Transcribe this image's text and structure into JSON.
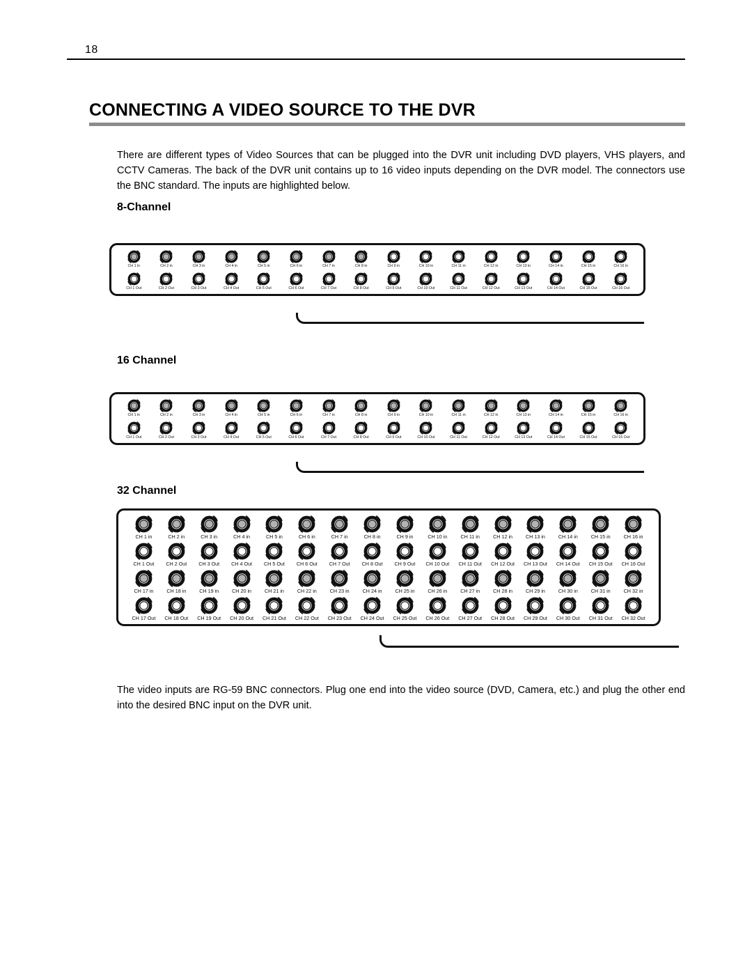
{
  "page": {
    "number": "18"
  },
  "title": "CONNECTING A VIDEO SOURCE TO THE DVR",
  "intro_paragraph": "There are different types of Video Sources that can be plugged into the DVR unit including DVD players, VHS players, and CCTV Cameras. The back of the DVR unit contains up to 16 video inputs depending on the DVR model. The connectors use the BNC standard.  The inputs are highlighted below.",
  "closing_paragraph": "The video inputs are RG-59 BNC connectors. Plug one end into the video source (DVD, Camera, etc.) and plug the other end into the desired BNC input on the DVR unit.",
  "colors": {
    "title_rule": "#8c8c8c",
    "panel_outline": "#111111",
    "input_jack_fill": "#b3b3b3",
    "output_jack_fill": "#ffffff"
  },
  "sections": [
    {
      "heading": "8-Channel",
      "rows": [
        {
          "type": "in",
          "labels": [
            "CH 1 in",
            "CH 2 in",
            "CH 3 in",
            "CH 4 in",
            "CH 5 in",
            "CH 6 in",
            "CH 7 in",
            "CH 8 in",
            "CH 9 in",
            "CH 10 in",
            "CH 11 in",
            "CH 12 in",
            "CH 13 in",
            "CH 14 in",
            "CH 15 in",
            "CH 16 in"
          ],
          "highlighted": [
            true,
            true,
            true,
            true,
            true,
            true,
            true,
            true,
            false,
            false,
            false,
            false,
            false,
            false,
            false,
            false
          ]
        },
        {
          "type": "out",
          "labels": [
            "CH 1 Out",
            "CH 2 Out",
            "CH 3 Out",
            "CH 4 Out",
            "CH 5 Out",
            "CH 6 Out",
            "CH 7 Out",
            "CH 8 Out",
            "CH 9 Out",
            "CH 10 Out",
            "CH 11 Out",
            "CH 12 Out",
            "CH 13 Out",
            "CH 14 Out",
            "CH 15 Out",
            "CH 16 Out"
          ],
          "highlighted": [
            false,
            false,
            false,
            false,
            false,
            false,
            false,
            false,
            false,
            false,
            false,
            false,
            false,
            false,
            false,
            false
          ]
        }
      ]
    },
    {
      "heading": "16 Channel",
      "rows": [
        {
          "type": "in",
          "labels": [
            "CH 1 in",
            "CH 2 in",
            "CH 3 in",
            "CH 4 in",
            "CH 5 in",
            "CH 6 in",
            "CH 7 in",
            "CH 8 in",
            "CH 9 in",
            "CH 10 in",
            "CH 11 in",
            "CH 12 in",
            "CH 13 in",
            "CH 14 in",
            "CH 15 in",
            "CH 16 in"
          ],
          "highlighted": [
            true,
            true,
            true,
            true,
            true,
            true,
            true,
            true,
            true,
            true,
            true,
            true,
            true,
            true,
            true,
            true
          ]
        },
        {
          "type": "out",
          "labels": [
            "CH 1 Out",
            "CH 2 Out",
            "CH 3 Out",
            "CH 4 Out",
            "CH 5 Out",
            "CH 6 Out",
            "CH 7 Out",
            "CH 8 Out",
            "CH 9 Out",
            "CH 10 Out",
            "CH 11 Out",
            "CH 12 Out",
            "CH 13 Out",
            "CH 14 Out",
            "CH 15 Out",
            "CH 16 Out"
          ],
          "highlighted": [
            false,
            false,
            false,
            false,
            false,
            false,
            false,
            false,
            false,
            false,
            false,
            false,
            false,
            false,
            false,
            false
          ]
        }
      ]
    },
    {
      "heading": "32 Channel",
      "rows": [
        {
          "type": "in",
          "labels": [
            "CH 1 in",
            "CH 2 in",
            "CH 3 in",
            "CH 4 in",
            "CH 5 in",
            "CH 6 in",
            "CH 7 in",
            "CH 8 in",
            "CH 9 in",
            "CH 10 in",
            "CH 11 in",
            "CH 12 in",
            "CH 13 in",
            "CH 14 in",
            "CH 15 in",
            "CH 16 in"
          ],
          "highlighted": [
            true,
            true,
            true,
            true,
            true,
            true,
            true,
            true,
            true,
            true,
            true,
            true,
            true,
            true,
            true,
            true
          ]
        },
        {
          "type": "out",
          "labels": [
            "CH 1 Out",
            "CH 2 Out",
            "CH 3 Out",
            "CH 4 Out",
            "CH 5 Out",
            "CH 6 Out",
            "CH 7 Out",
            "CH 8 Out",
            "CH 9 Out",
            "CH 10 Out",
            "CH 11 Out",
            "CH 12 Out",
            "CH 13 Out",
            "CH 14 Out",
            "CH 15 Out",
            "CH 16 Out"
          ],
          "highlighted": [
            false,
            false,
            false,
            false,
            false,
            false,
            false,
            false,
            false,
            false,
            false,
            false,
            false,
            false,
            false,
            false
          ]
        },
        {
          "type": "in",
          "labels": [
            "CH 17 in",
            "CH 18 in",
            "CH 19 in",
            "CH 20 in",
            "CH 21 in",
            "CH 22 in",
            "CH 23 in",
            "CH 24 in",
            "CH 25 in",
            "CH 26 in",
            "CH 27 in",
            "CH 28 in",
            "CH 29 in",
            "CH 30 in",
            "CH 31 in",
            "CH 32 in"
          ],
          "highlighted": [
            true,
            true,
            true,
            true,
            true,
            true,
            true,
            true,
            true,
            true,
            true,
            true,
            true,
            true,
            true,
            true
          ]
        },
        {
          "type": "out",
          "labels": [
            "CH 17 Out",
            "CH 18 Out",
            "CH 19 Out",
            "CH 20 Out",
            "CH 21 Out",
            "CH 22 Out",
            "CH 23 Out",
            "CH 24 Out",
            "CH 25 Out",
            "CH 26 Out",
            "CH 27 Out",
            "CH 28 Out",
            "CH 29 Out",
            "CH 30 Out",
            "CH 31 Out",
            "CH 32 Out"
          ],
          "highlighted": [
            false,
            false,
            false,
            false,
            false,
            false,
            false,
            false,
            false,
            false,
            false,
            false,
            false,
            false,
            false,
            false
          ]
        }
      ]
    }
  ]
}
